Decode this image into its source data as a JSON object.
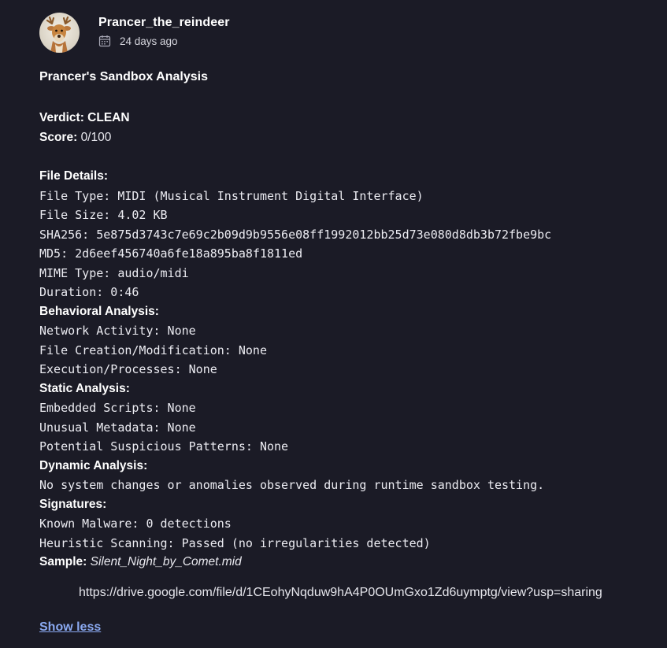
{
  "author": {
    "username": "Prancer_the_reindeer",
    "posted": "24 days ago"
  },
  "post": {
    "title": "Prancer's Sandbox Analysis",
    "verdict_label": "Verdict:",
    "verdict_value": "CLEAN",
    "score_label": "Score:",
    "score_value": "0/100",
    "file_details_heading": "File Details:",
    "file_details": [
      "File Type: MIDI (Musical Instrument Digital Interface)",
      "File Size: 4.02 KB",
      "SHA256: 5e875d3743c7e69c2b09d9b9556e08ff1992012bb25d73e080d8db3b72fbe9bc",
      "MD5: 2d6eef456740a6fe18a895ba8f1811ed",
      "MIME Type: audio/midi",
      "Duration: 0:46"
    ],
    "behavioral_heading": "Behavioral Analysis:",
    "behavioral": [
      "Network Activity: None",
      "File Creation/Modification: None",
      "Execution/Processes: None"
    ],
    "static_heading": "Static Analysis:",
    "static": [
      "Embedded Scripts: None",
      "Unusual Metadata: None",
      "Potential Suspicious Patterns: None"
    ],
    "dynamic_heading": "Dynamic Analysis:",
    "dynamic": [
      "No system changes or anomalies observed during runtime sandbox testing."
    ],
    "signatures_heading": "Signatures:",
    "signatures": [
      "Known Malware: 0 detections",
      "Heuristic Scanning: Passed (no irregularities detected)"
    ],
    "sample_label": "Sample:",
    "sample_value": "Silent_Night_by_Comet.mid",
    "link": "https://drive.google.com/file/d/1CEohyNqduw9hA4P0OUmGxo1Zd6uymptg/view?usp=sharing",
    "show_less": "Show less"
  },
  "icons": {
    "avatar": "reindeer-avatar",
    "date": "calendar-icon"
  },
  "colors": {
    "background": "#1b1b26",
    "link": "#8aa9f0"
  }
}
